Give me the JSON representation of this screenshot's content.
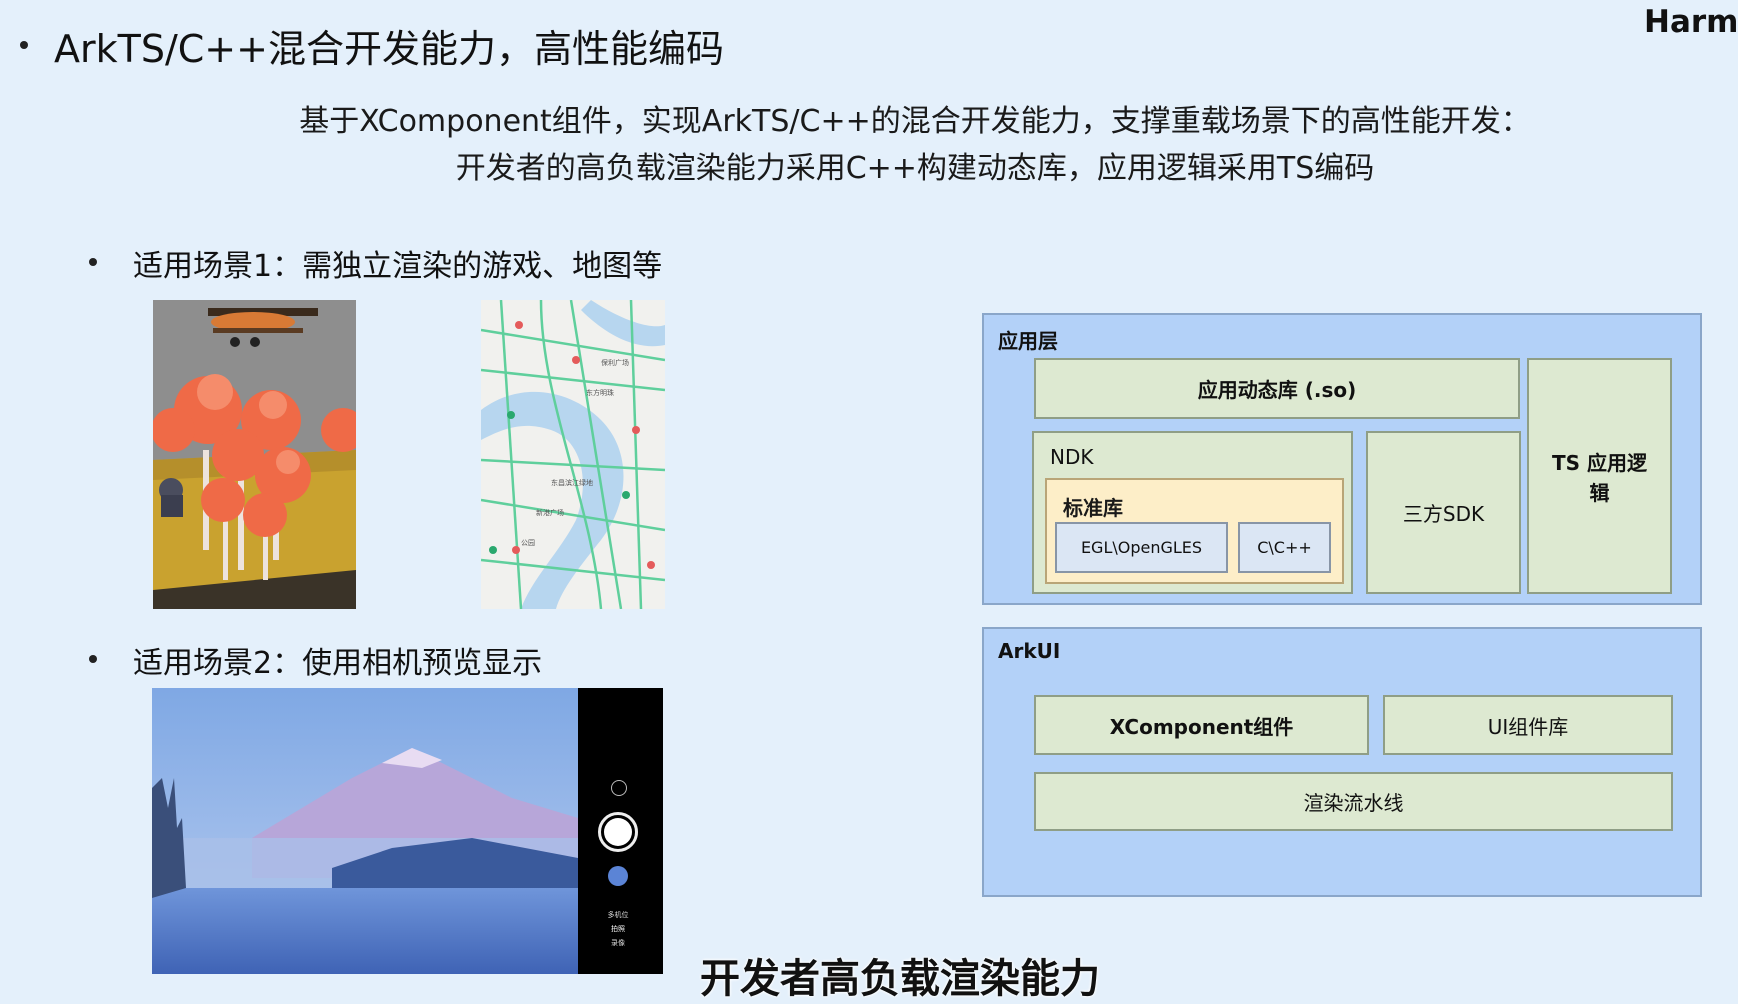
{
  "brand": "Harmo",
  "title": "ArkTS/C++混合开发能力，高性能编码",
  "description": {
    "line1": "基于XComponent组件，实现ArkTS/C++的混合开发能力，支撑重载场景下的高性能开发：",
    "line2": "开发者的高负载渲染能力采用C++构建动态库，应用逻辑采用TS编码"
  },
  "scenario1": "适用场景1：需独立渲染的游戏、地图等",
  "scenario2": "适用场景2：使用相机预览显示",
  "map_labels": [
    "保利广场",
    "东昌滨江绿地",
    "新港广场",
    "东方明珠",
    "公园"
  ],
  "camera_ui": {
    "mode_label": "多机位",
    "photo_label": "拍照",
    "video_label": "录像"
  },
  "diagram": {
    "app_layer": {
      "label": "应用层",
      "dynlib": "应用动态库 (.so)",
      "ndk": "NDK",
      "stdlib": "标准库",
      "egl": "EGL\\OpenGLES",
      "cpp": "C\\C++",
      "sdk": "三方SDK",
      "ts_logic": "TS 应用逻辑"
    },
    "arkui": {
      "label": "ArkUI",
      "xcomponent": "XComponent组件",
      "ui_lib": "UI组件库",
      "pipeline": "渲染流水线"
    }
  },
  "subtitle": "开发者高负载渲染能力"
}
